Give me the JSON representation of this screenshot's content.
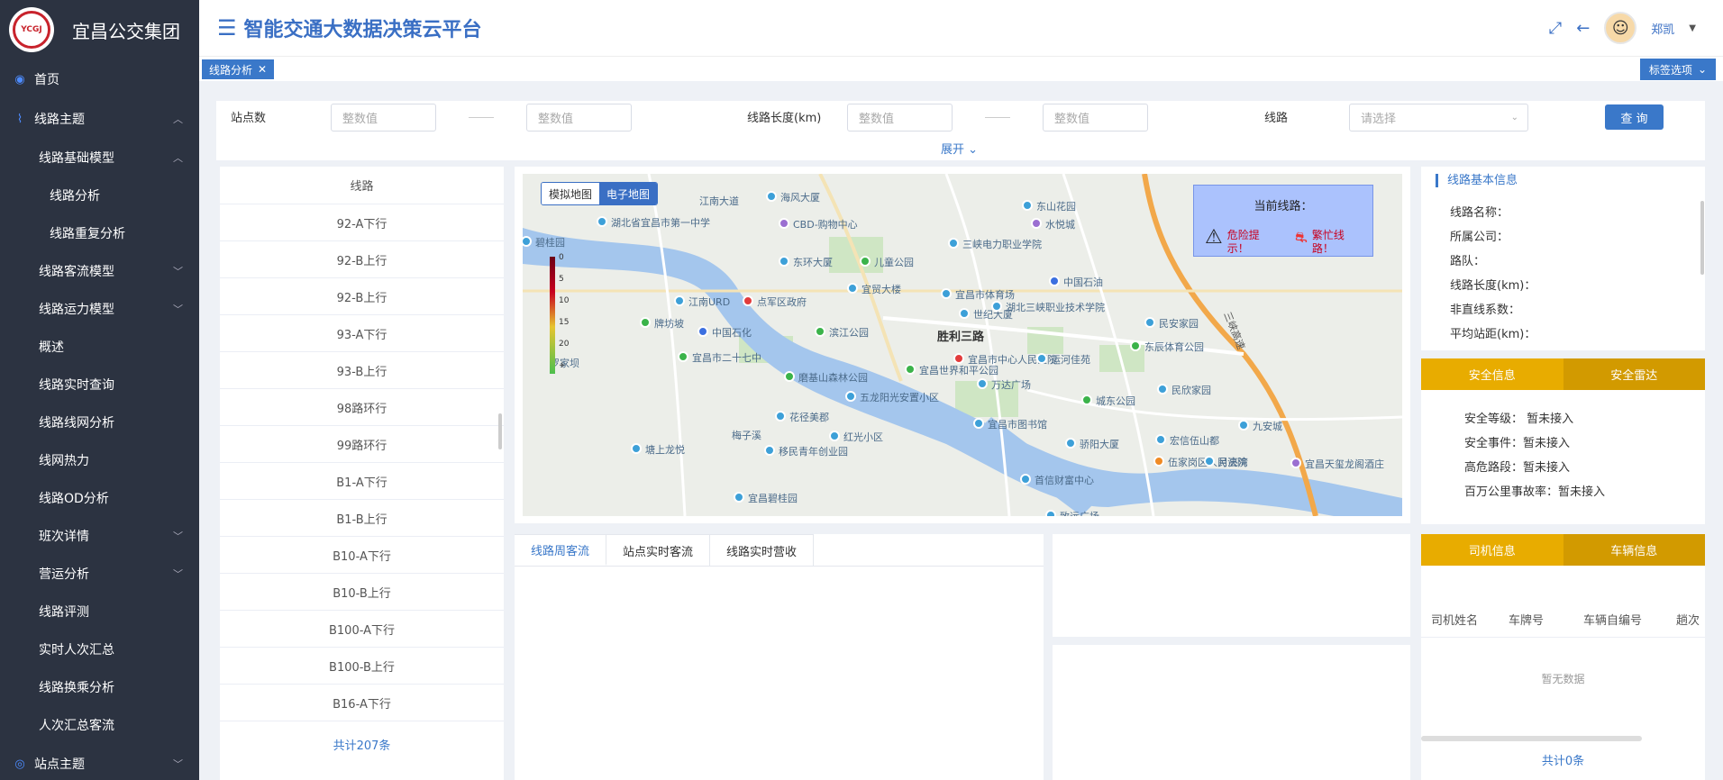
{
  "brand": {
    "name": "宜昌公交集团",
    "logo_text": "YCGJ"
  },
  "sidebar": {
    "items": [
      {
        "label": "首页",
        "level": 1,
        "icon": "home-icon"
      },
      {
        "label": "线路主题",
        "level": 1,
        "icon": "route-icon",
        "expanded": true
      },
      {
        "label": "线路基础模型",
        "level": 2,
        "expanded": true
      },
      {
        "label": "线路分析",
        "level": 3
      },
      {
        "label": "线路重复分析",
        "level": 3
      },
      {
        "label": "线路客流模型",
        "level": 2
      },
      {
        "label": "线路运力模型",
        "level": 2
      },
      {
        "label": "概述",
        "level": 2
      },
      {
        "label": "线路实时查询",
        "level": 2
      },
      {
        "label": "线路线网分析",
        "level": 2
      },
      {
        "label": "线网热力",
        "level": 2
      },
      {
        "label": "线路OD分析",
        "level": 2
      },
      {
        "label": "班次详情",
        "level": 2
      },
      {
        "label": "营运分析",
        "level": 2
      },
      {
        "label": "线路评测",
        "level": 2
      },
      {
        "label": "实时人次汇总",
        "level": 2
      },
      {
        "label": "线路换乘分析",
        "level": 2
      },
      {
        "label": "人次汇总客流",
        "level": 2
      },
      {
        "label": "站点主题",
        "level": 1,
        "icon": "station-icon"
      }
    ]
  },
  "header": {
    "title": "智能交通大数据决策云平台",
    "user": "郑凯"
  },
  "tagbar": {
    "active_tag": "线路分析",
    "options_label": "标签选项"
  },
  "filter": {
    "station_count_label": "站点数",
    "station_min_placeholder": "整数值",
    "station_max_placeholder": "整数值",
    "length_label": "线路长度(km)",
    "length_min_placeholder": "整数值",
    "length_max_placeholder": "整数值",
    "route_label": "线路",
    "route_placeholder": "请选择",
    "query_label": "查 询",
    "expand_label": "展开"
  },
  "routes": {
    "header": "线路",
    "rows": [
      "92-A下行",
      "92-B上行",
      "92-B上行",
      "93-A下行",
      "93-B上行",
      "98路环行",
      "99路环行",
      "B1-A下行",
      "B1-B上行",
      "B10-A下行",
      "B10-B上行",
      "B100-A下行",
      "B100-B上行",
      "B16-A下行"
    ],
    "total": "共计207条"
  },
  "map": {
    "toggle_sim": "模拟地图",
    "toggle_elec": "电子地图",
    "legend_ticks": [
      "0",
      "5",
      "10",
      "15",
      "20",
      "+"
    ],
    "current_route_title": "当前线路：",
    "danger_label": "危险提示！",
    "congestion_label": "繁忙线路！",
    "labels": [
      "湖北省宜昌市第一中学",
      "碧桂园",
      "江南大道",
      "CBD-购物中心",
      "海风大厦",
      "东山花园",
      "三峡电力职业学院",
      "水悦城",
      "东环大厦",
      "儿童公园",
      "中国石油",
      "江南URD",
      "点军区政府",
      "宜贸大楼",
      "宜昌市体育场",
      "世纪大厦",
      "湖北三峡职业技术学院",
      "民安家园",
      "牌坊坡",
      "中国石化",
      "滨江公园",
      "胜利三路",
      "宜昌市二十七中",
      "宜昌市中心人民医院",
      "运河佳苑",
      "东辰体育公园",
      "磨基山森林公园",
      "宜昌世界和平公园",
      "万达广场",
      "民欣家园",
      "五龙阳光安置小区",
      "城东公园",
      "花径美郡",
      "梅子溪",
      "宜昌市图书馆",
      "九安城",
      "红光小区",
      "塘上龙悦",
      "移民青年创业园",
      "骄阳大厦",
      "宏信伍山都",
      "伍家岗区人民法院",
      "月亮湾",
      "宜昌天玺龙阁酒庄",
      "首信财富中心",
      "宜昌碧桂园",
      "致远广场",
      "罗家坝",
      "三峡高速"
    ]
  },
  "bottom_tabs": [
    "线路周客流",
    "站点实时客流",
    "线路实时营收"
  ],
  "route_info": {
    "title": "线路基本信息",
    "fields": [
      "线路名称：",
      "所属公司：",
      "路队：",
      "线路长度(km)：",
      "非直线系数：",
      "平均站距(km)："
    ]
  },
  "safety": {
    "tabs": [
      "安全信息",
      "安全雷达"
    ],
    "rows": [
      "安全等级： 暂未接入",
      "安全事件：暂未接入",
      "高危路段：暂未接入",
      "百万公里事故率：暂未接入"
    ]
  },
  "driver": {
    "tabs": [
      "司机信息",
      "车辆信息"
    ],
    "columns": [
      "司机姓名",
      "车牌号",
      "车辆自编号",
      "趟次"
    ],
    "empty": "暂无数据",
    "total": "共计0条"
  },
  "colors": {
    "accent": "#3a78c9",
    "sidebar": "#2c3341",
    "gold": "#e8ac00",
    "gold_dark": "#d29a00",
    "danger": "#c8001e"
  }
}
